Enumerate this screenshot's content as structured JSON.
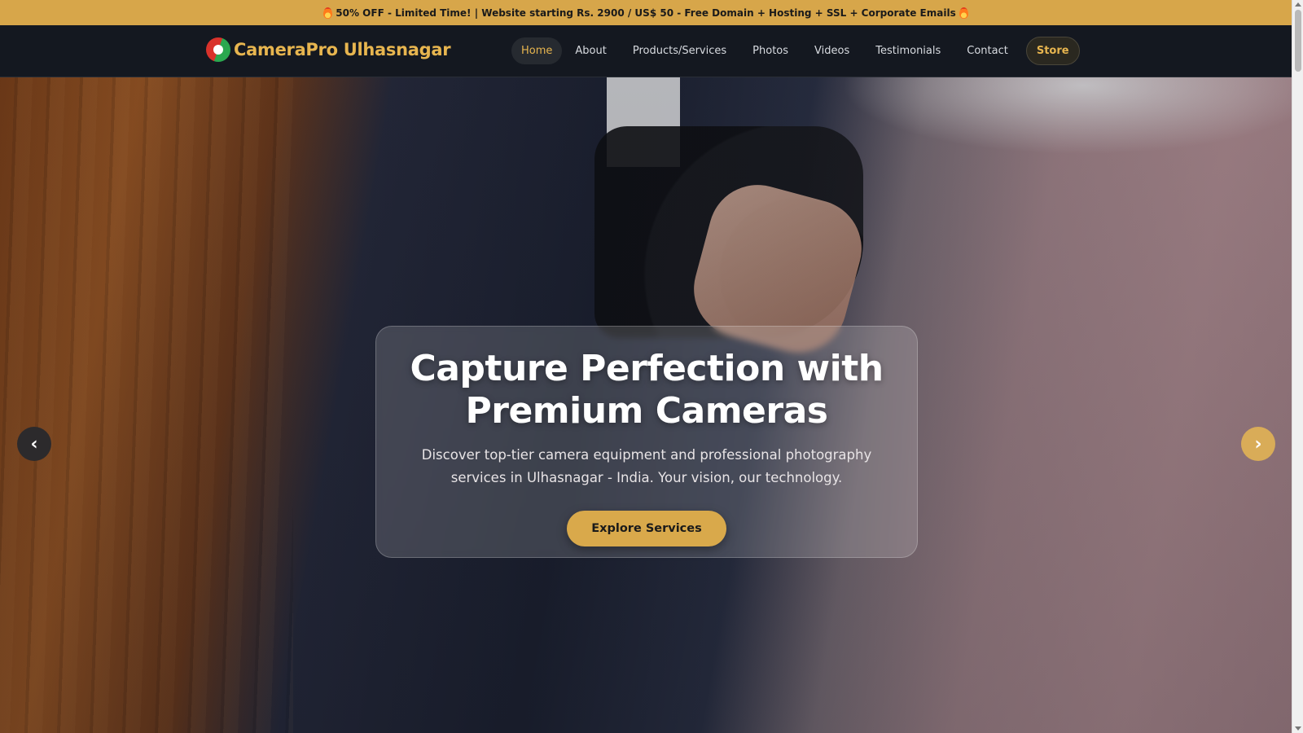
{
  "promo": {
    "text": "50% OFF - Limited Time! | Website starting Rs. 2900 / US$ 50 - Free Domain + Hosting + SSL + Corporate Emails",
    "icon": "flame-icon"
  },
  "brand": {
    "name": "CameraPro Ulhasnagar",
    "logo": "brand-logo"
  },
  "nav": {
    "items": [
      {
        "label": "Home",
        "active": true
      },
      {
        "label": "About"
      },
      {
        "label": "Products/Services"
      },
      {
        "label": "Photos"
      },
      {
        "label": "Videos"
      },
      {
        "label": "Testimonials"
      },
      {
        "label": "Contact"
      },
      {
        "label": "Store",
        "highlight": true
      }
    ]
  },
  "hero": {
    "title_line1": "Capture Perfection with",
    "title_line2": "Premium Cameras",
    "subtitle": "Discover top-tier camera equipment and professional photography services in Ulhasnagar - India. Your vision, our technology.",
    "cta_label": "Explore Services",
    "prev_arrow": "‹",
    "next_arrow": "›"
  },
  "colors": {
    "accent": "#d9a94b",
    "nav_bg": "#141820",
    "promo_bg": "#d7a64a",
    "brand_text": "#e7b54f"
  }
}
